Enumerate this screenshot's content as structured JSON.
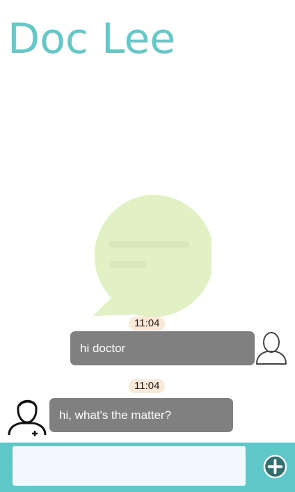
{
  "header": {
    "title": "Doc Lee"
  },
  "messages": [
    {
      "time": "11:04",
      "text": "hi doctor",
      "sender": "user"
    },
    {
      "time": "11:04",
      "text": "hi, what's the matter?",
      "sender": "doctor"
    }
  ],
  "composer": {
    "placeholder": ""
  },
  "icons": {
    "watermark": "chat-bubble-icon",
    "user_avatar": "user-outline-icon",
    "doctor_avatar": "doctor-icon",
    "add": "plus-circle-icon"
  },
  "colors": {
    "accent": "#62c9c9",
    "bar": "#5ec8c8",
    "bubble": "#808080",
    "time_badge": "#fbe9d7",
    "watermark": "#e2f1c4",
    "input_bg": "#f1f8ff"
  }
}
